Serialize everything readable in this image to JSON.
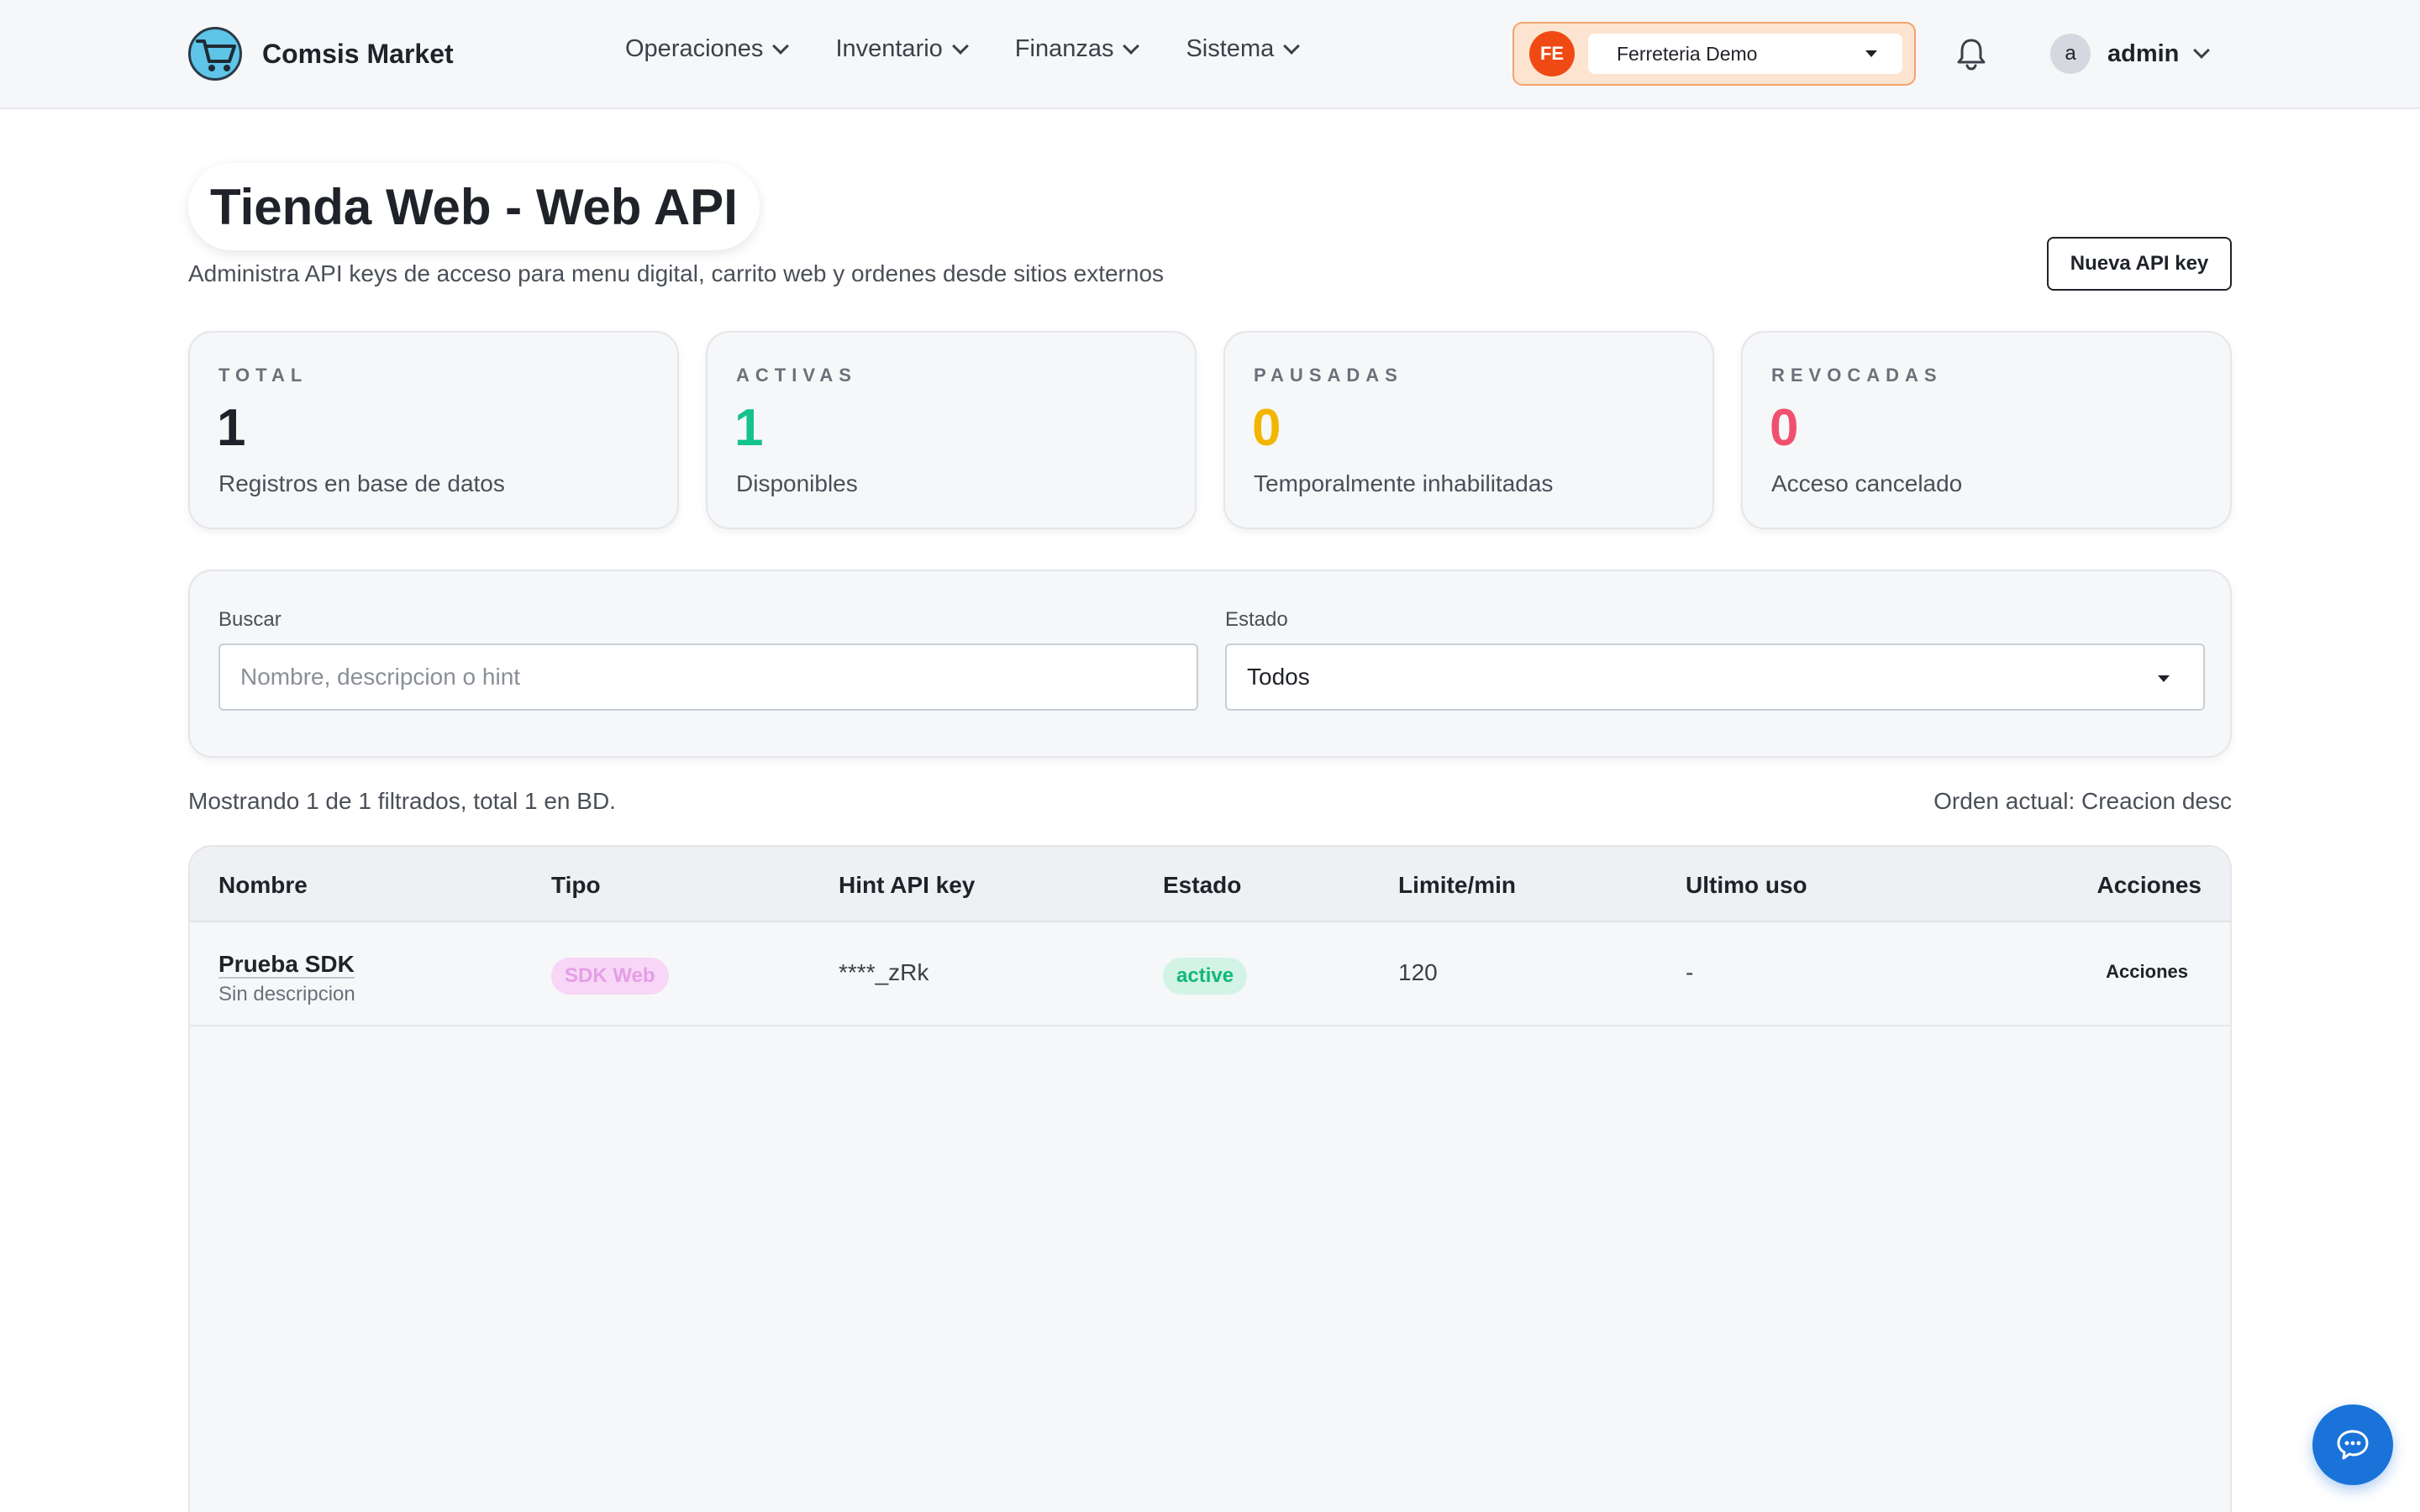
{
  "navbar": {
    "brand_name": "Comsis Market",
    "menu": [
      {
        "label": "Operaciones"
      },
      {
        "label": "Inventario"
      },
      {
        "label": "Finanzas"
      },
      {
        "label": "Sistema"
      }
    ],
    "store": {
      "initials": "FE",
      "name": "Ferreteria Demo"
    },
    "user": {
      "initial": "a",
      "name": "admin"
    }
  },
  "header": {
    "title": "Tienda Web - Web API",
    "subtitle": "Administra API keys de acceso para menu digital, carrito web y ordenes desde sitios externos",
    "new_button": "Nueva API key"
  },
  "stats": [
    {
      "label": "TOTAL",
      "value": "1",
      "desc": "Registros en base de datos",
      "color": "#1f2329"
    },
    {
      "label": "ACTIVAS",
      "value": "1",
      "desc": "Disponibles",
      "color": "#13c38a"
    },
    {
      "label": "PAUSADAS",
      "value": "0",
      "desc": "Temporalmente inhabilitadas",
      "color": "#f2b600"
    },
    {
      "label": "REVOCADAS",
      "value": "0",
      "desc": "Acceso cancelado",
      "color": "#f0506e"
    }
  ],
  "filters": {
    "search_label": "Buscar",
    "search_placeholder": "Nombre, descripcion o hint",
    "search_value": "",
    "state_label": "Estado",
    "state_value": "Todos"
  },
  "meta": {
    "showing": "Mostrando 1 de 1 filtrados, total 1 en BD.",
    "order": "Orden actual: Creacion desc"
  },
  "table": {
    "headers": [
      "Nombre",
      "Tipo",
      "Hint API key",
      "Estado",
      "Limite/min",
      "Ultimo uso",
      "Acciones"
    ],
    "rows": [
      {
        "name": "Prueba SDK",
        "description": "Sin descripcion",
        "type": "SDK Web",
        "hint": "****_zRk",
        "state": "active",
        "limit": "120",
        "last_use": "-",
        "actions": "Acciones"
      }
    ]
  },
  "icons": {
    "brand": "shopping-cart-icon",
    "notifications": "bell-icon",
    "chat": "chat-bubble-icon"
  }
}
